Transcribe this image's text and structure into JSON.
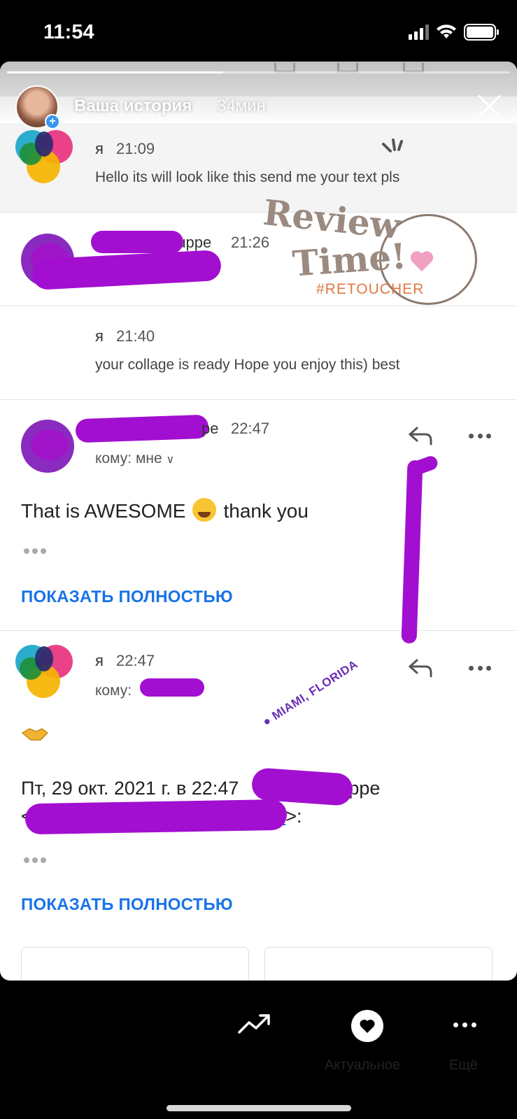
{
  "status_bar": {
    "time": "11:54"
  },
  "story": {
    "title": "Ваша история",
    "time_ago": "34мин.",
    "progress_fraction": 0.43
  },
  "emails": [
    {
      "sender": "я",
      "time": "21:09",
      "snippet": "Hello its will look like this send me your text pls"
    },
    {
      "sender": "ruppe",
      "time": "21:26",
      "snippet": ""
    },
    {
      "sender": "я",
      "time": "21:40",
      "snippet": "your collage is ready Hope you enjoy this) best"
    }
  ],
  "opened_email_1": {
    "sender": "pe",
    "time": "22:47",
    "to_line": "кому: мне",
    "body_before": "That is AWESOME",
    "body_after": "thank you",
    "show_full": "ПОКАЗАТЬ ПОЛНОСТЬЮ"
  },
  "opened_email_2": {
    "sender": "я",
    "time": "22:47",
    "to_line": "кому:",
    "quote_line1": "Пт, 29 окт. 2021 г. в 22:47",
    "quote_suffix": "Gruppe",
    "quote_line2_start": "<",
    "quote_link": "m",
    "quote_line2_end": ">:",
    "show_full": "ПОКАЗАТЬ ПОЛНОСТЬЮ"
  },
  "stickers": {
    "review_word1": "Review",
    "review_word2": "Time!",
    "retoucher": "#RETOUCHER",
    "location": "MIAMI, FLORIDA"
  },
  "bottom_bar": {
    "highlight_label": "Актуальное",
    "more_label": "Ещё"
  },
  "icons": [
    "signal-icon",
    "wifi-icon",
    "battery-icon",
    "close-icon",
    "reply-icon",
    "more-icon",
    "trending-icon",
    "heart-icon"
  ]
}
